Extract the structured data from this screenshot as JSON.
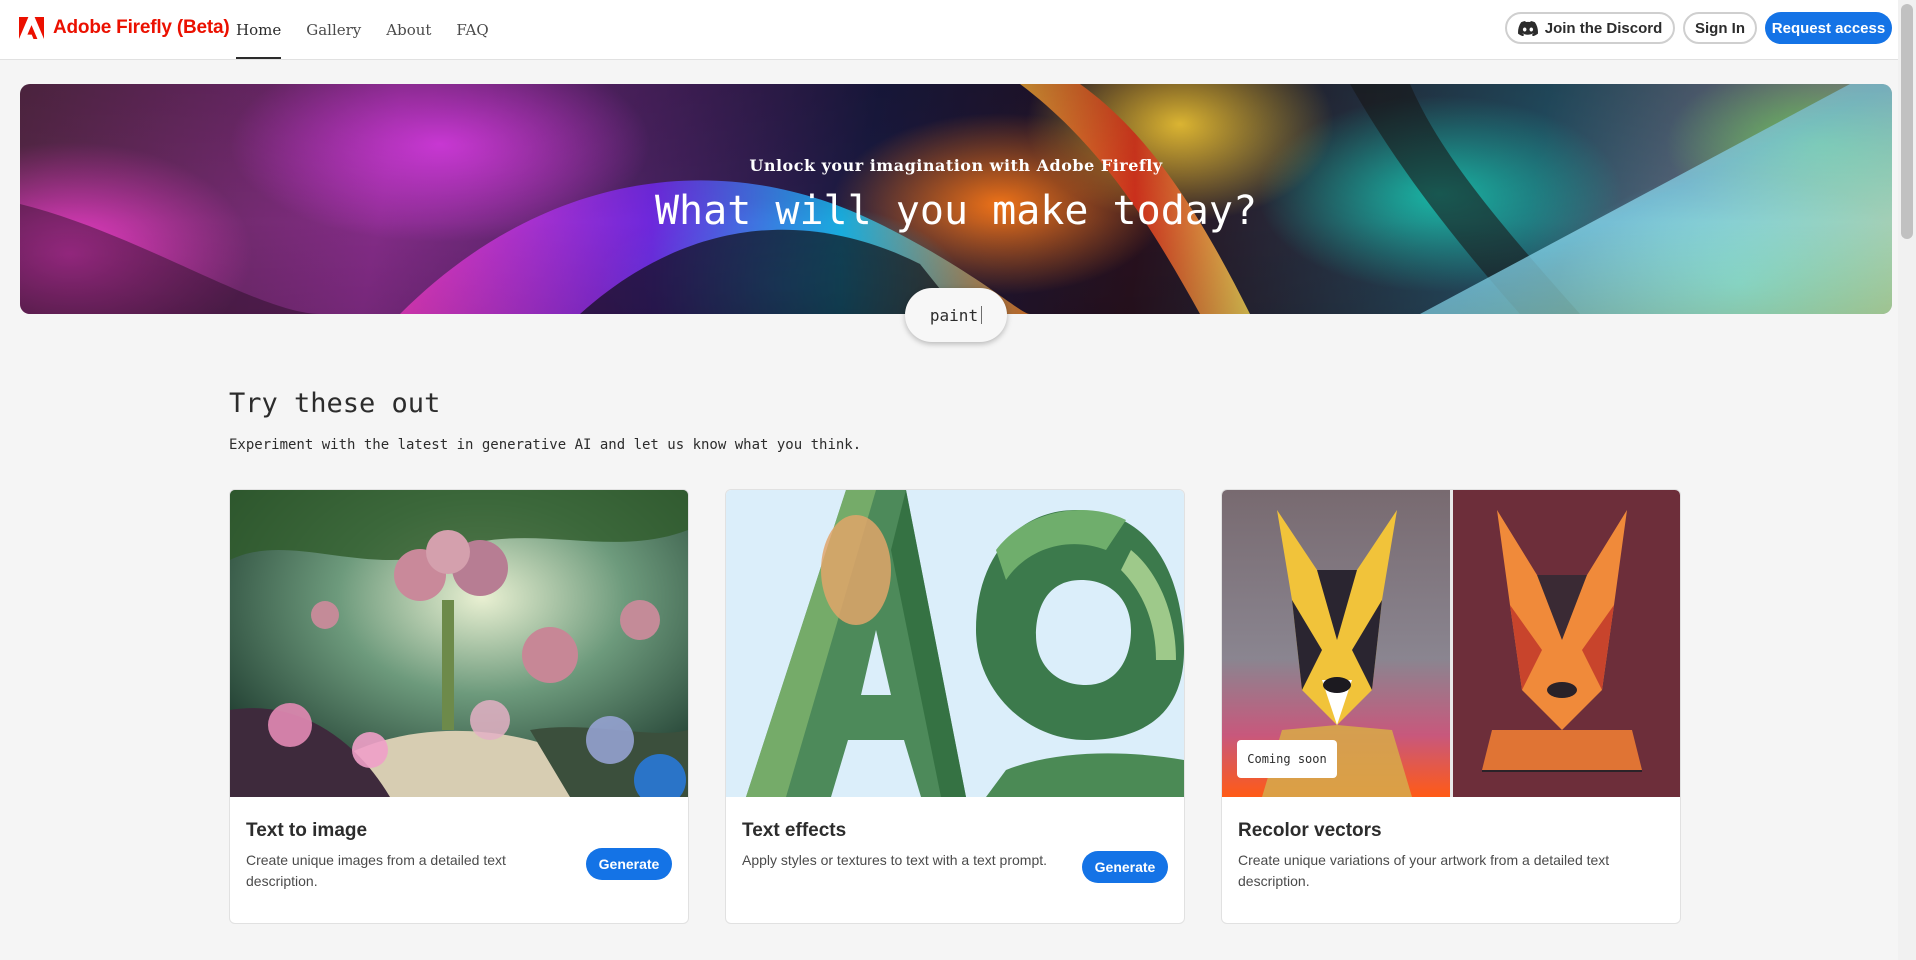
{
  "header": {
    "brand": "Adobe Firefly (Beta)",
    "nav": [
      {
        "label": "Home",
        "active": true
      },
      {
        "label": "Gallery",
        "active": false
      },
      {
        "label": "About",
        "active": false
      },
      {
        "label": "FAQ",
        "active": false
      }
    ],
    "discord_label": "Join the Discord",
    "signin_label": "Sign In",
    "request_label": "Request access"
  },
  "hero": {
    "kicker": "Unlock your imagination with Adobe Firefly",
    "title": "What will you make today?",
    "prompt_value": "paint"
  },
  "section": {
    "title": "Try these out",
    "subtitle": "Experiment with the latest in generative AI and let us know what you think."
  },
  "cards": [
    {
      "title": "Text to image",
      "description": "Create unique images from a detailed text description.",
      "button": "Generate"
    },
    {
      "title": "Text effects",
      "description": "Apply styles or textures to text with a text prompt.",
      "button": "Generate"
    },
    {
      "title": "Recolor vectors",
      "description": "Create unique variations of your artwork from a detailed text description.",
      "badge": "Coming soon"
    }
  ],
  "colors": {
    "brand_red": "#eb1000",
    "accent_blue": "#1473e6",
    "page_bg": "#f5f5f5"
  },
  "icons": [
    "adobe-logo-icon",
    "discord-icon"
  ]
}
